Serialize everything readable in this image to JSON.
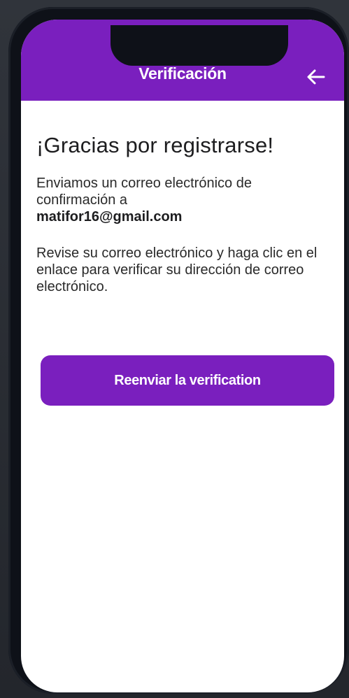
{
  "header": {
    "title": "Verificación",
    "back_icon": "arrow-left-icon"
  },
  "main": {
    "title": "¡Gracias por registrarse!",
    "sent_message": "Enviamos un correo electrónico de confirmación a",
    "email": "matifor16@gmail.com",
    "instructions": "Revise su correo electrónico y haga clic en el enlace para verificar su dirección de correo electrónico.",
    "resend_button_label": "Reenviar la verification"
  },
  "colors": {
    "accent": "#7a1fbe",
    "background": "#ffffff",
    "device_frame": "#0e1118"
  }
}
